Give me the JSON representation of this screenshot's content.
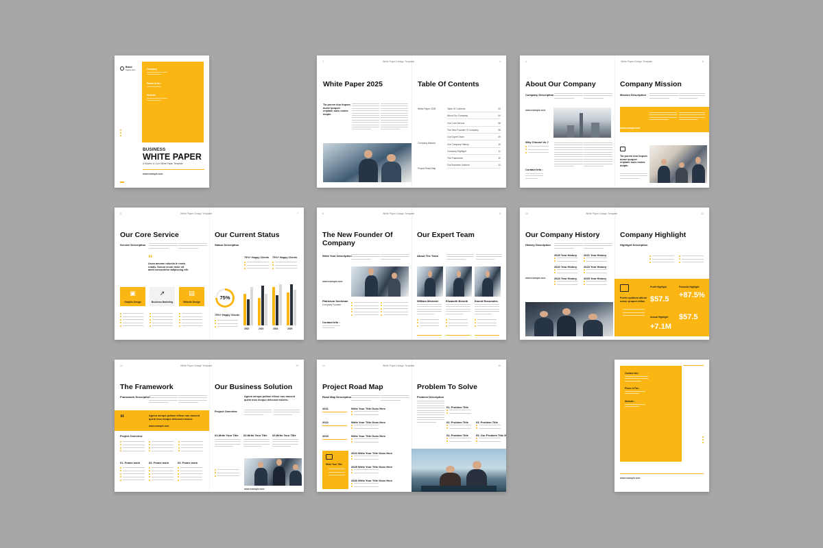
{
  "cover": {
    "logo_title": "Brand",
    "logo_sub": "Tagline Here",
    "company_label": "Company",
    "phone_label": "Phone & Fax :",
    "website_label": "Website :",
    "title_small": "BUSINESS",
    "title_big": "WHITE PAPER",
    "subtitle": "A Modern & Core White Paper Template",
    "url": "www.example.com"
  },
  "spread1": {
    "page_left": "2",
    "page_right": "3",
    "running_title": "White Paper Design Template",
    "left_title": "White Paper 2025",
    "left_lead": "Tia porem duo tiopum dume ipuquer eriplaim aues moins dolpte.",
    "right_title": "Table Of Contents",
    "toc_groups": [
      "White Paper 2025",
      "Company Mission",
      "Project Road Map"
    ],
    "toc": [
      {
        "label": "Table Of Contents",
        "page": "03"
      },
      {
        "label": "About Our Company",
        "page": "04"
      },
      {
        "label": "Our Core Service",
        "page": "06"
      },
      {
        "label": "The New Founder Of Company",
        "page": "08"
      },
      {
        "label": "Our Expert Team",
        "page": "09"
      },
      {
        "label": "Our Company History",
        "page": "10"
      },
      {
        "label": "Company Highlight",
        "page": "11"
      },
      {
        "label": "The Framework",
        "page": "12"
      },
      {
        "label": "Our Business Solution",
        "page": "13"
      }
    ]
  },
  "spread2": {
    "page_left": "4",
    "page_right": "5",
    "running_title": "White Paper Design Template",
    "left_title": "About Our Company",
    "left_label": "Company Description",
    "why_label": "Why Choose Us ?",
    "contact_label": "Contact Info :",
    "right_title": "Company Mission",
    "right_label": "Mission Description",
    "right_lead": "Tia porem duo tiopum dume ipuquer eriplaim aues moins dolpte.",
    "url": "www.example.com"
  },
  "spread3": {
    "page_left": "6",
    "page_right": "7",
    "running_title": "White Paper Design Template",
    "left_title": "Our Core Service",
    "left_label": "Service Description",
    "quote": "Arum amome nductia le remis relatis. Dolum enum dolor sit amet consectetur adipiscing elit.",
    "services": [
      "Graphic Design",
      "Business Marketing",
      "Website Design"
    ],
    "right_title": "Our Current Status",
    "right_label": "Status Description",
    "clients_a": "75%+ Happy Clients",
    "clients_b": "75%+ Happy Clients",
    "clients_c": "75%+ Happy Clients",
    "ring_value": "75%",
    "years": [
      "2022",
      "2023",
      "2024",
      "2025"
    ]
  },
  "spread4": {
    "page_left": "8",
    "page_right": "9",
    "running_title": "White Paper Design Template",
    "left_title_1": "The New Founder Of",
    "left_title_2": "Company",
    "left_label": "Write Your Description",
    "founder_name": "Patricium Sochman",
    "founder_role": "Company Founder",
    "contact_label": "Contact Info :",
    "url": "www.example.com",
    "right_title": "Our Expert Team",
    "right_label": "About The Team",
    "team": [
      "William Mrizeder",
      "Elizabeth Beneth",
      "Emmit Rosumdes"
    ]
  },
  "spread5": {
    "page_left": "10",
    "page_right": "11",
    "running_title": "White Paper Design Template",
    "left_title": "Our Company History",
    "left_label": "History Description",
    "history": [
      "2020 Year History",
      "2021 Year History",
      "2022 Year History",
      "2023 Year History",
      "2024 Year History",
      "2025 Year History"
    ],
    "url": "www.example.com",
    "right_title": "Company Highlight",
    "right_label": "Highlight Description",
    "hl_lead": "Porfer quidium allium nonur proped willus",
    "profit_label": "Profit Highlight",
    "financial_label": "Financial Highlight",
    "annual_label": "Annual Highlight",
    "profit_value": "$57.5",
    "financial_value": "+87.5%",
    "annual_value": "+7.1M",
    "extra_value": "$57.5"
  },
  "spread6": {
    "page_left": "12",
    "page_right": "13",
    "running_title": "White Paper Design Template",
    "left_title": "The Framework",
    "left_label": "Framework Description",
    "quote_text": "Agnon seropo pulboe ellisor nos rascont quem mos moquo delcusst maxers.",
    "url": "www.example.com",
    "overview_label": "Project Overview",
    "frames": [
      "01. Frame work",
      "02. Frame work",
      "03. Frame work"
    ],
    "right_title": "Our Business Solution",
    "right_lead": "Agnon seropo pulboe ellisor nos rascont quem mos moquo delcusst maxers.",
    "right_overview": "Project Overview",
    "titles": [
      "01.Write Your Title",
      "02.Write Your Title",
      "03.Write Your Title"
    ],
    "url2": "www.example.com"
  },
  "spread7": {
    "page_left": "14",
    "page_right": "15",
    "running_title": "White Paper Design Template",
    "left_title": "Project Road Map",
    "left_label": "Road Map Description",
    "road_years": [
      "2021",
      "2022",
      "2023"
    ],
    "road_titles": [
      "Write Your Title Goes Here",
      "Write Your Title Goes Here",
      "Write Your Title Goes Here",
      "2024 Write Your Title Goes Here",
      "2025 Write Your Title Goes Here",
      "2026 Write Your Title Goes Here"
    ],
    "box_title": "Write Your Title",
    "right_title": "Problem To Solve",
    "right_label": "Problem Description",
    "problems": [
      "01. Problem Title",
      "02. Problem Title",
      "03. Problem Title",
      "04. Problem Title",
      "05. Our Problem Title Here"
    ]
  },
  "back": {
    "contact_label": "Contact Info :",
    "phone_label": "Phone & Fax :",
    "website_label": "Website :",
    "url": "www.example.com"
  },
  "colors": {
    "accent": "#fbb613",
    "background": "#a7a7a7"
  }
}
